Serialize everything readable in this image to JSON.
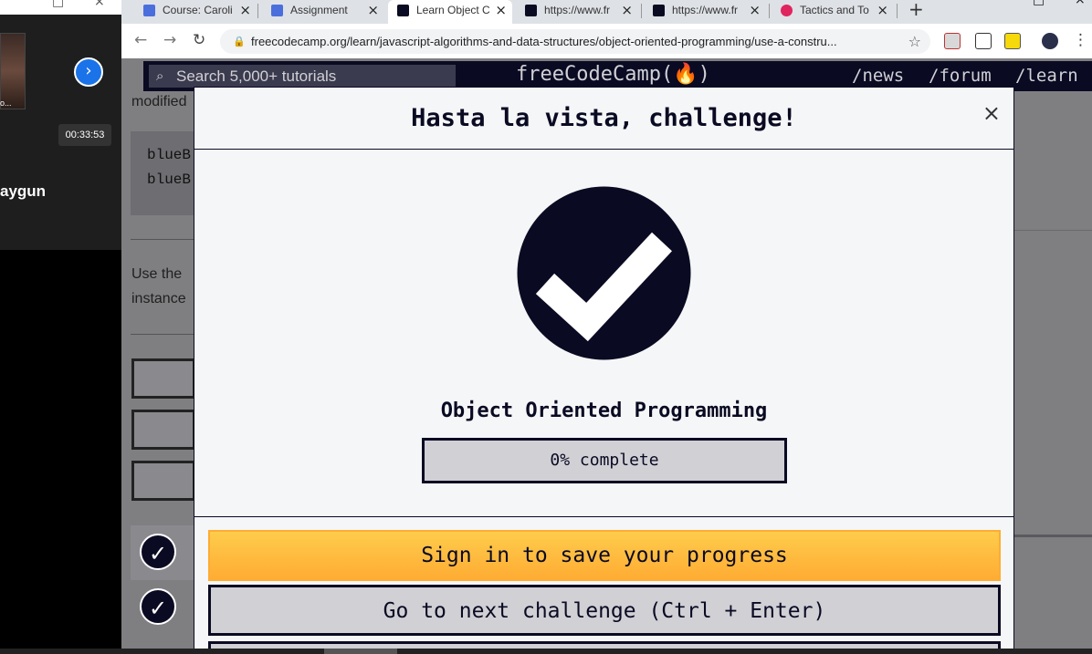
{
  "left_panel": {
    "thumb_caption": "o...",
    "timer": "00:33:53",
    "participant_name": "aygun"
  },
  "tabs": [
    {
      "label": "Course: Caroli",
      "favicon_color": "#4a6fdc"
    },
    {
      "label": "Assignment",
      "favicon_color": "#4a6fdc"
    },
    {
      "label": "Learn Object C",
      "favicon_color": "#0a0a23"
    },
    {
      "label": "https://www.fr",
      "favicon_color": "#0a0a23"
    },
    {
      "label": "https://www.fr",
      "favicon_color": "#0a0a23"
    },
    {
      "label": "Tactics and To",
      "favicon_color": "#e0245e"
    }
  ],
  "new_tab_icon": "+",
  "url": "freecodecamp.org/learn/javascript-algorithms-and-data-structures/object-oriented-programming/use-a-constru...",
  "fcc_nav": {
    "search_placeholder": "Search 5,000+ tutorials",
    "logo": "freeCodeCamp(🔥)",
    "links": [
      "/news",
      "/forum",
      "/learn"
    ]
  },
  "background": {
    "text_modified": "modified",
    "code_lines": [
      "blueB",
      "blueB"
    ],
    "text_use_the": "Use the",
    "text_instance": "instance"
  },
  "modal": {
    "title": "Hasta la vista, challenge!",
    "close_icon": "×",
    "block_title": "Object Oriented Programming",
    "progress_percent": 0,
    "progress_label": "0% complete",
    "signin_button": "Sign in to save your progress",
    "next_button": "Go to next challenge (Ctrl + Enter)"
  },
  "colors": {
    "fcc_dark": "#0a0a23",
    "signin_yellow": "#ffac33"
  }
}
